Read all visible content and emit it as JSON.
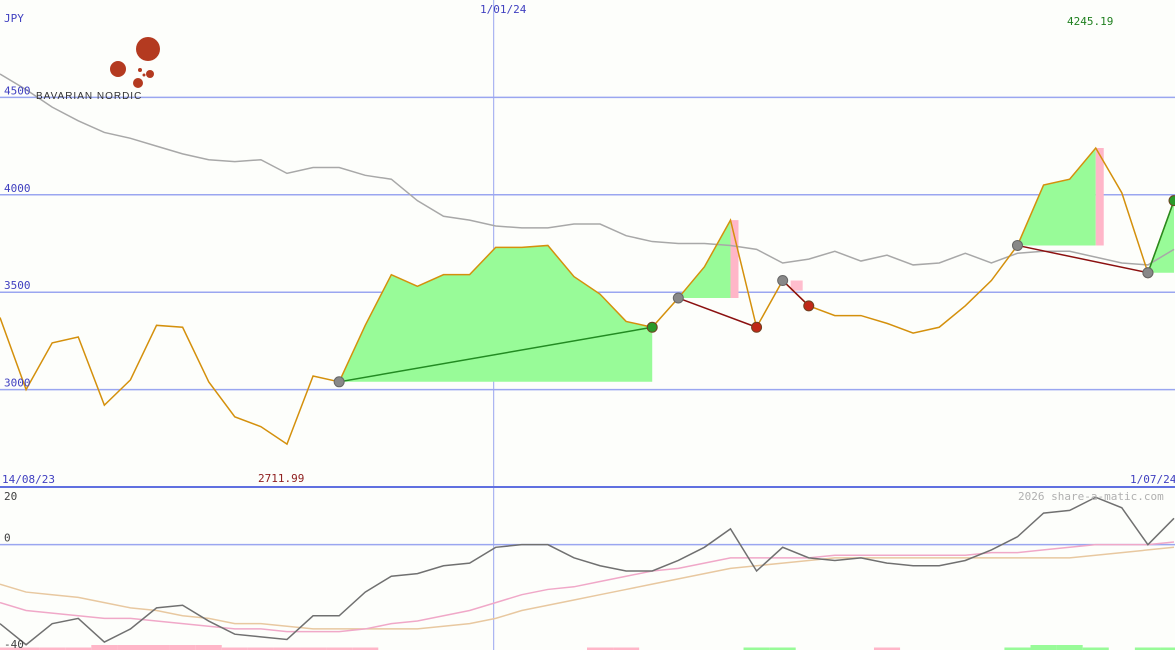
{
  "chart_data": [
    {
      "type": "line",
      "currency_label": "JPY",
      "logo_text": "BAVARIAN NORDIC",
      "date_labels": [
        "14/08/23",
        "1/01/24",
        "1/07/24"
      ],
      "max_label": "4245.19",
      "min_label": "2711.99",
      "ylim": [
        2500,
        5000
      ],
      "y_ticks": [
        3000,
        3500,
        4000,
        4500
      ],
      "y_tick_labels": [
        "3000",
        "3500",
        "4000",
        "4500"
      ],
      "series": [
        {
          "values": [
            3370,
            3000,
            3240,
            3270,
            2920,
            3050,
            3330,
            3320,
            3040,
            2860,
            2810,
            2720,
            3070,
            3040,
            3330,
            3590,
            3530,
            3590,
            3590,
            3730,
            3730,
            3740,
            3580,
            3490,
            3350,
            3320,
            3470,
            3630,
            3870,
            3320,
            3560,
            3430,
            3380,
            3380,
            3340,
            3290,
            3320,
            3430,
            3560,
            3740,
            4050,
            4080,
            4240,
            4010,
            3600,
            3970
          ]
        },
        {
          "values": [
            4620,
            4540,
            4450,
            4380,
            4320,
            4290,
            4250,
            4210,
            4180,
            4170,
            4180,
            4110,
            4140,
            4140,
            4100,
            4080,
            3970,
            3890,
            3870,
            3840,
            3830,
            3830,
            3850,
            3850,
            3790,
            3760,
            3750,
            3750,
            3740,
            3720,
            3650,
            3670,
            3710,
            3660,
            3690,
            3640,
            3650,
            3700,
            3650,
            3700,
            3710,
            3710,
            3680,
            3650,
            3640,
            3720
          ]
        }
      ],
      "signals": [
        {
          "from": 13,
          "to": 25,
          "kind": "rise"
        },
        {
          "from": 26,
          "to": 29,
          "kind": "fall"
        },
        {
          "from": 30,
          "to": 31,
          "kind": "fall"
        },
        {
          "from": 39,
          "to": 44,
          "kind": "fall"
        },
        {
          "from": 44,
          "to": 45,
          "kind": "rise"
        }
      ],
      "colors": {
        "price": "#d4900c",
        "average": "#a8a8a8",
        "rise_fill": "#98fb98",
        "fall_fill": "#ffb6c8",
        "rise_line": "#228b22",
        "fall_line": "#8b1010",
        "grid": "#9aa6f0",
        "label": "#4040c0"
      }
    },
    {
      "type": "line",
      "ylim": [
        -40,
        20
      ],
      "y_ticks": [
        20,
        0,
        -40
      ],
      "y_tick_labels": [
        "20",
        "0",
        "-40"
      ],
      "credit": "2026 share-a-matic.com",
      "series": [
        {
          "values": [
            -30,
            -38,
            -30,
            -28,
            -37,
            -32,
            -24,
            -23,
            -29,
            -34,
            -35,
            -36,
            -27,
            -27,
            -18,
            -12,
            -11,
            -8,
            -7,
            -1,
            0,
            0,
            -5,
            -8,
            -10,
            -10,
            -6,
            -1,
            6,
            -10,
            -1,
            -5,
            -6,
            -5,
            -7,
            -8,
            -8,
            -6,
            -2,
            3,
            12,
            13,
            18,
            14,
            0,
            10
          ]
        },
        {
          "values": [
            -22,
            -25,
            -26,
            -27,
            -28,
            -28,
            -29,
            -30,
            -31,
            -32,
            -32,
            -33,
            -33,
            -33,
            -32,
            -30,
            -29,
            -27,
            -25,
            -22,
            -19,
            -17,
            -16,
            -14,
            -12,
            -10,
            -9,
            -7,
            -5,
            -5,
            -5,
            -5,
            -4,
            -4,
            -4,
            -4,
            -4,
            -4,
            -3,
            -3,
            -2,
            -1,
            0,
            0,
            0,
            1
          ]
        },
        {
          "values": [
            -15,
            -18,
            -19,
            -20,
            -22,
            -24,
            -25,
            -27,
            -28,
            -30,
            -30,
            -31,
            -32,
            -32,
            -32,
            -32,
            -32,
            -31,
            -30,
            -28,
            -25,
            -23,
            -21,
            -19,
            -17,
            -15,
            -13,
            -11,
            -9,
            -8,
            -7,
            -6,
            -5,
            -5,
            -5,
            -5,
            -5,
            -5,
            -5,
            -5,
            -5,
            -5,
            -4,
            -3,
            -2,
            -1
          ]
        }
      ],
      "bars": [
        -1,
        -1,
        -1,
        -1,
        -2,
        -2,
        -2,
        -2,
        -2,
        -1,
        -1,
        -1,
        -1,
        -1,
        -1,
        0,
        0,
        0,
        0,
        0,
        0,
        0,
        0,
        -1,
        -1,
        0,
        0,
        0,
        0,
        1,
        1,
        0,
        0,
        0,
        -1,
        0,
        0,
        0,
        0,
        1,
        2,
        2,
        1,
        0,
        1,
        1
      ],
      "colors": {
        "momentum": "#707070",
        "signal": "#f0a8c8",
        "slow": "#e8c8a0",
        "bar_up": "#98fb98",
        "bar_down": "#ffb6c8"
      }
    }
  ]
}
